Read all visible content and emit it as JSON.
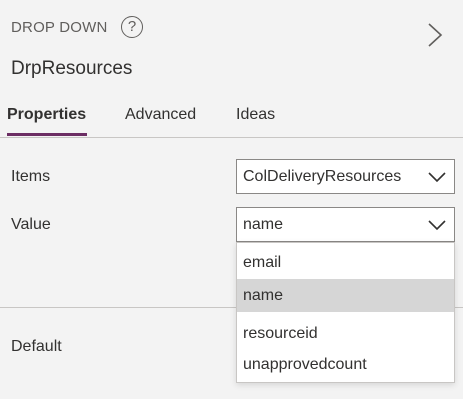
{
  "header": {
    "control_type": "DROP DOWN",
    "help_icon_glyph": "?",
    "control_name": "DrpResources",
    "next_icon": "chevron-right-icon"
  },
  "tabs": [
    {
      "label": "Properties",
      "active": true
    },
    {
      "label": "Advanced",
      "active": false
    },
    {
      "label": "Ideas",
      "active": false
    }
  ],
  "properties": {
    "items": {
      "label": "Items",
      "value": "ColDeliveryResources"
    },
    "value": {
      "label": "Value",
      "value": "name"
    },
    "default": {
      "label": "Default"
    }
  },
  "value_dropdown": {
    "open": true,
    "options": [
      "email",
      "name",
      "resourceid",
      "unapprovedcount"
    ],
    "selected": "name"
  },
  "colors": {
    "accent": "#6b2d63",
    "background": "#f3f3f3",
    "selected_option": "#d6d6d6"
  }
}
